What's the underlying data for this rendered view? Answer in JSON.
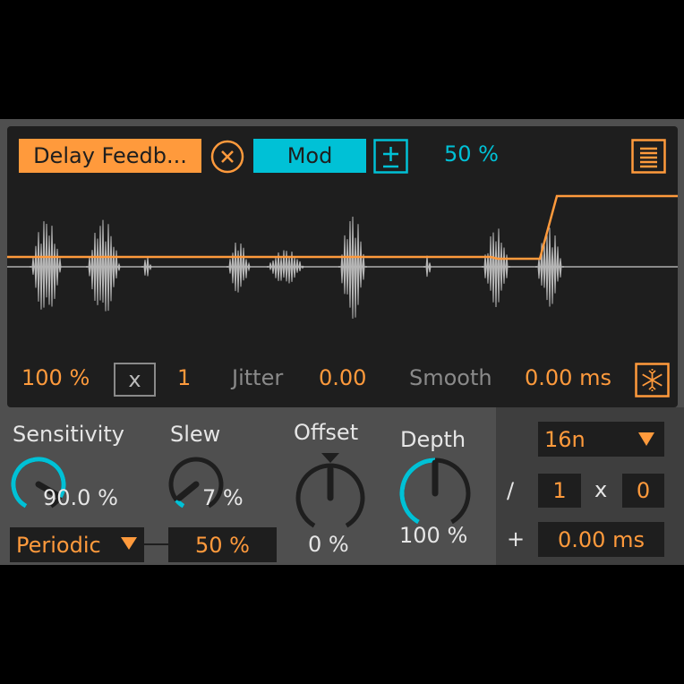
{
  "header": {
    "parameter_label": "Delay Feedb...",
    "mode_label": "Mod",
    "amount": "50 %"
  },
  "display": {
    "gain": "100 %",
    "multiply_symbol": "x",
    "multiplier": "1",
    "jitter_label": "Jitter",
    "jitter_value": "0.00",
    "smooth_label": "Smooth",
    "smooth_value": "0.00 ms"
  },
  "knobs": {
    "sensitivity": {
      "label": "Sensitivity",
      "value": "90.0 %",
      "level": 0.9
    },
    "slew": {
      "label": "Slew",
      "value": "7 %",
      "level": 0.07
    },
    "offset": {
      "label": "Offset",
      "value": "0 %",
      "level": 0
    },
    "depth": {
      "label": "Depth",
      "value": "100 %",
      "level": 1.0
    }
  },
  "trigger": {
    "mode": "Periodic",
    "value": "50 %"
  },
  "rate": {
    "division": "16n",
    "divide_symbol": "/",
    "divisor": "1",
    "times_symbol": "x",
    "factor": "0",
    "plus_symbol": "+",
    "offset": "0.00 ms"
  },
  "icons": {
    "remove": "close-circle-icon",
    "polarity": "plus-minus-icon",
    "menu": "list-icon",
    "freeze": "snowflake-icon",
    "dropdown": "triangle-down-icon"
  },
  "colors": {
    "accent": "#ff9a3c",
    "mod": "#00c1d6",
    "panel": "#4f4f4f",
    "display": "#1e1e1e"
  }
}
